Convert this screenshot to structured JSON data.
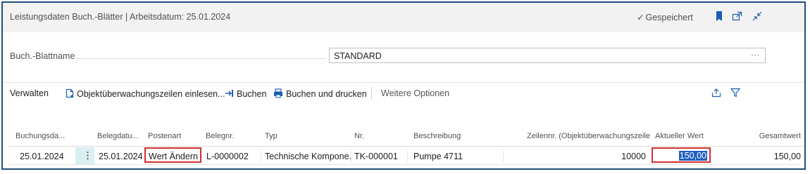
{
  "header": {
    "title": "Leistungsdaten Buch.-Blätter | Arbeitsdatum: 25.01.2024",
    "saved_label": "Gespeichert"
  },
  "field": {
    "label": "Buch.-Blattname",
    "value": "STANDARD",
    "more": "···"
  },
  "actions": {
    "manage": "Verwalten",
    "load_lines": "Objektüberwachungszeilen einlesen...",
    "post": "Buchen",
    "post_print": "Buchen und drucken",
    "more_options": "Weitere Optionen"
  },
  "table": {
    "columns": [
      "Buchungsda...",
      "Belegdatu...",
      "Postenart",
      "Belegnr.",
      "Typ",
      "Nr.",
      "Beschreibung",
      "Zeilennr. (Objektüberwachungszeile)",
      "Aktueller Wert",
      "Gesamtwert"
    ],
    "rows": [
      {
        "buchungsdatum": "25.01.2024",
        "belegdatum": "25.01.2024",
        "postenart": "Wert Ändern",
        "belegnr": "L-0000002",
        "typ": "Technische Kompone...",
        "nr": "TK-000001",
        "beschreibung": "Pumpe 4711",
        "zeilennr": "10000",
        "aktueller_wert": "150,00",
        "gesamtwert": "150,00"
      }
    ]
  },
  "colors": {
    "frame": "#1f4e79",
    "accent": "#1a5fb4",
    "highlight_box": "#d32f2f",
    "selection": "#d9f0f3"
  }
}
